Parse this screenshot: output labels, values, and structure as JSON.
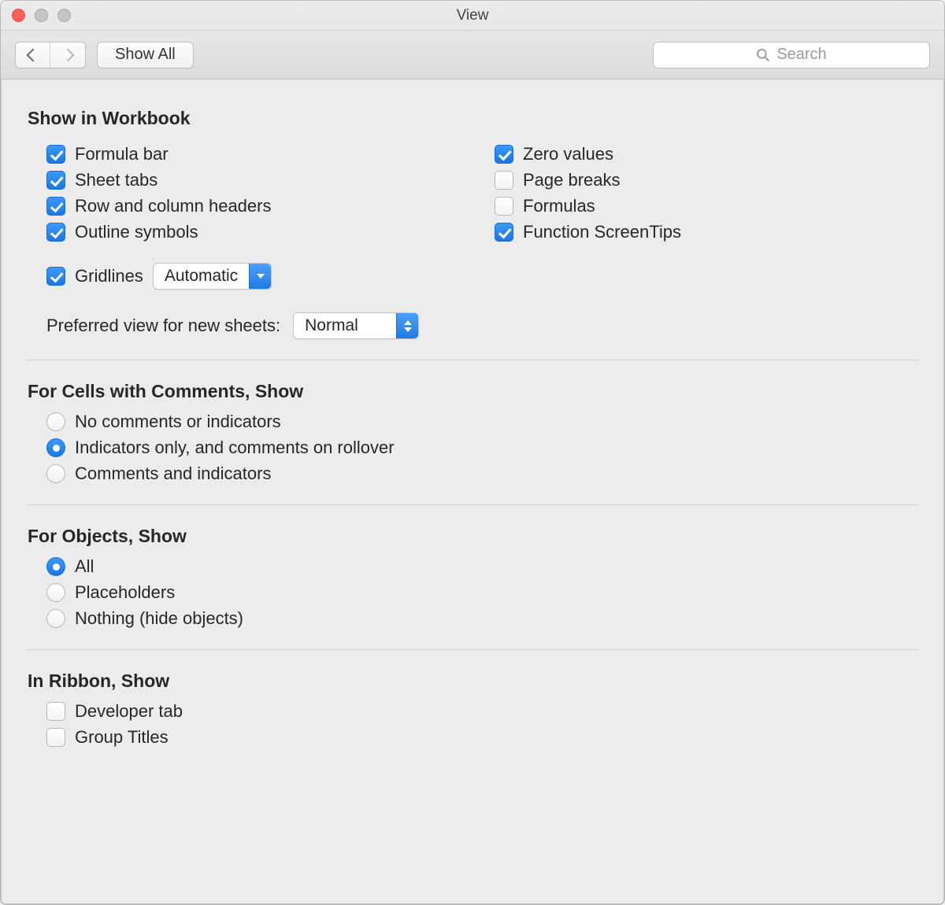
{
  "window": {
    "title": "View"
  },
  "toolbar": {
    "show_all_label": "Show All",
    "search_placeholder": "Search"
  },
  "sections": {
    "show_in_workbook": {
      "title": "Show in Workbook",
      "left": [
        {
          "label": "Formula bar",
          "checked": true
        },
        {
          "label": "Sheet tabs",
          "checked": true
        },
        {
          "label": "Row and column headers",
          "checked": true
        },
        {
          "label": "Outline symbols",
          "checked": true
        }
      ],
      "gridlines": {
        "label": "Gridlines",
        "checked": true,
        "mode": "Automatic"
      },
      "right": [
        {
          "label": "Zero values",
          "checked": true
        },
        {
          "label": "Page breaks",
          "checked": false
        },
        {
          "label": "Formulas",
          "checked": false
        },
        {
          "label": "Function ScreenTips",
          "checked": true
        }
      ],
      "preferred_view": {
        "label": "Preferred view for new sheets:",
        "value": "Normal"
      }
    },
    "comments": {
      "title": "For Cells with Comments, Show",
      "options": [
        {
          "label": "No comments or indicators",
          "selected": false
        },
        {
          "label": "Indicators only, and comments on rollover",
          "selected": true
        },
        {
          "label": "Comments and indicators",
          "selected": false
        }
      ]
    },
    "objects": {
      "title": "For Objects, Show",
      "options": [
        {
          "label": "All",
          "selected": true
        },
        {
          "label": "Placeholders",
          "selected": false
        },
        {
          "label": "Nothing (hide objects)",
          "selected": false
        }
      ]
    },
    "ribbon": {
      "title": "In Ribbon, Show",
      "options": [
        {
          "label": "Developer tab",
          "checked": false
        },
        {
          "label": "Group Titles",
          "checked": false
        }
      ]
    }
  }
}
